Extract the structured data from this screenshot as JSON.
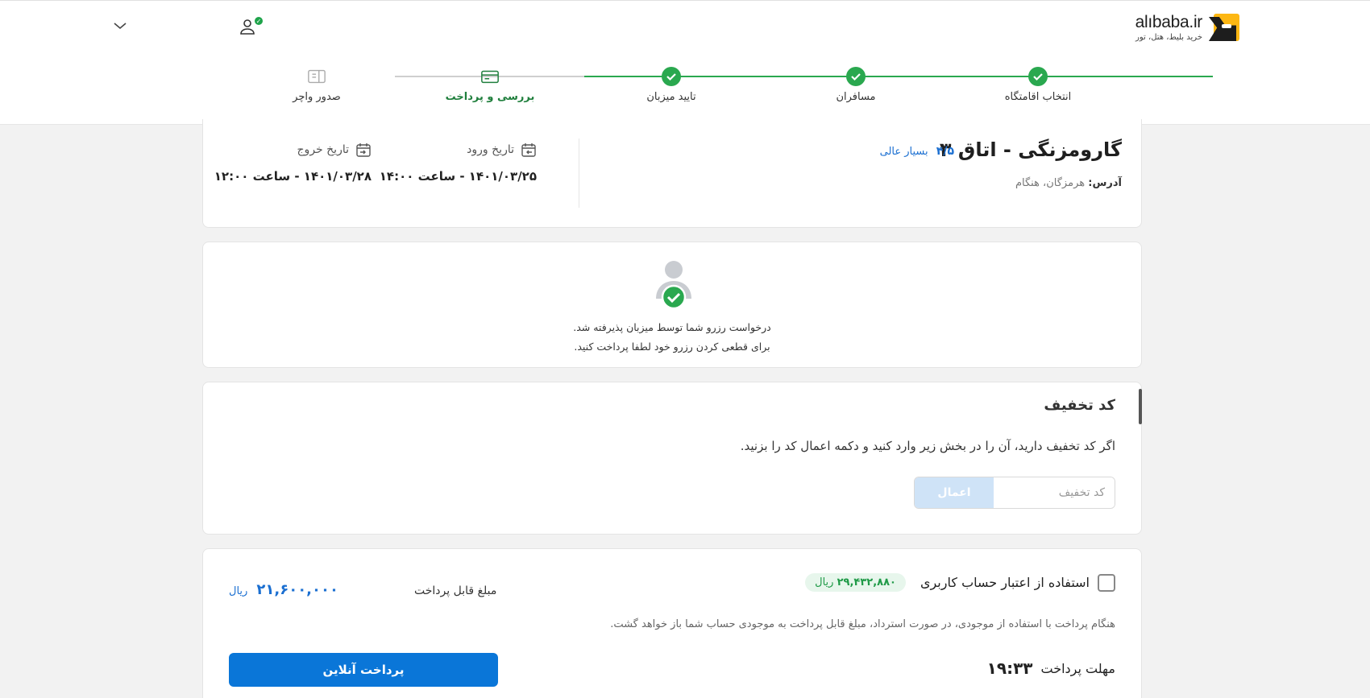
{
  "header": {
    "logo": {
      "brand": "alıbaba.ir",
      "tagline": "خرید بلیط، هتل، تور"
    },
    "user_icon": "user-icon",
    "menu_icon": "chevron-down-icon"
  },
  "stepper": {
    "steps": [
      {
        "label": "انتخاب اقامتگاه",
        "state": "done"
      },
      {
        "label": "مسافران",
        "state": "done"
      },
      {
        "label": "تایید میزبان",
        "state": "done"
      },
      {
        "label": "بررسی و پرداخت",
        "state": "active"
      },
      {
        "label": "صدور واچر",
        "state": "pending"
      }
    ]
  },
  "hotel": {
    "title": "گارومزنگی - اتاق ۳",
    "score": "۴/۵",
    "score_word": "بسیار عالی",
    "address_label": "آدرس:",
    "address_value": "هرمزگان، هنگام",
    "checkin_label": "تاریخ ورود",
    "checkin_value": "۱۴۰۱/۰۳/۲۵ - ساعت ۱۴:۰۰",
    "checkout_label": "تاریخ خروج",
    "checkout_value": "۱۴۰۱/۰۳/۲۸ - ساعت ۱۲:۰۰"
  },
  "acceptance": {
    "line1": "درخواست رزرو شما توسط میزبان پذیرفته شد.",
    "line2": "برای قطعی کردن رزرو خود لطفا پرداخت کنید."
  },
  "discount": {
    "title": "کد تخفیف",
    "description": "اگر کد تخفیف دارید، آن را در بخش زیر وارد کنید و دکمه اعمال کد را بزنید.",
    "placeholder": "کد تخفیف",
    "value": "",
    "apply_label": "اعمال"
  },
  "payment": {
    "credit_label": "استفاده از اعتبار حساب کاربری",
    "credit_checked": false,
    "credit_amount": "۲۹,۴۳۲,۸۸۰",
    "credit_currency": "ریال",
    "note": "هنگام پرداخت با استفاده از موجودی، در صورت استرداد، مبلغ قابل پرداخت به موجودی حساب شما باز خواهد گشت.",
    "payable_label": "مبلغ قابل پرداخت",
    "payable_amount": "۲۱,۶۰۰,۰۰۰",
    "payable_currency": "ریال",
    "deadline_label": "مهلت پرداخت",
    "deadline_time": "۱۹:۳۳",
    "pay_button": "پرداخت آنلاین"
  },
  "colors": {
    "success": "#2aa84f",
    "primary": "#0a76d8",
    "accent_blue": "#1b6fd1"
  }
}
